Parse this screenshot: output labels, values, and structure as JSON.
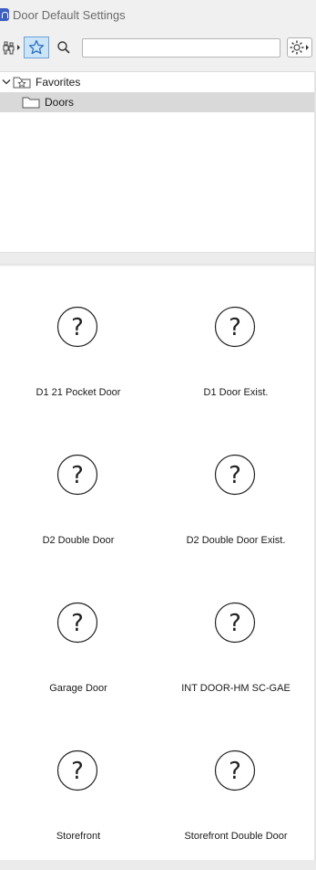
{
  "window": {
    "title": "Door Default Settings"
  },
  "toolbar": {
    "search_placeholder": ""
  },
  "tree": [
    {
      "label": "Favorites",
      "icon": "star-folder-icon",
      "expanded": true,
      "selected": false
    },
    {
      "label": "Doors",
      "icon": "folder-icon",
      "selected": true
    }
  ],
  "items": [
    {
      "label": "D1 21 Pocket Door"
    },
    {
      "label": "D1 Door Exist."
    },
    {
      "label": "D2 Double Door"
    },
    {
      "label": "D2 Double Door Exist."
    },
    {
      "label": "Garage Door"
    },
    {
      "label": "INT DOOR-HM SC-GAE"
    },
    {
      "label": "Storefront"
    },
    {
      "label": "Storefront Double Door"
    }
  ],
  "colors": {
    "accent": "#3d5fc4",
    "selected_button": "#cce4f7",
    "selected_row": "#d9d9d9"
  }
}
